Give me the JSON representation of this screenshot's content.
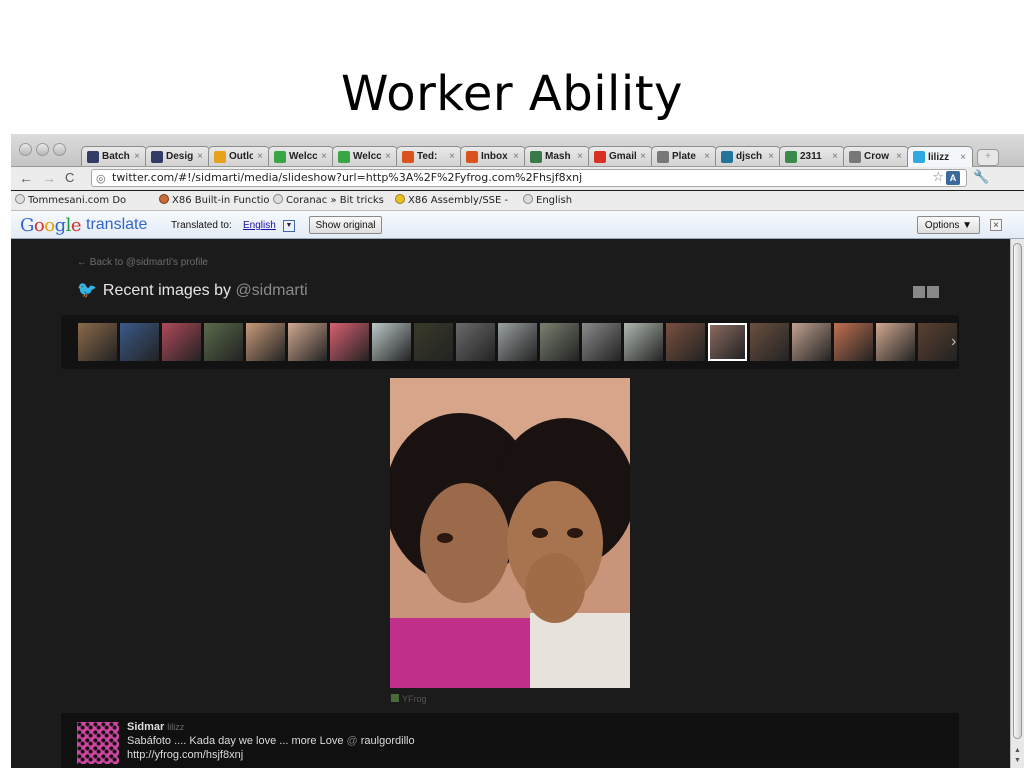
{
  "slide": {
    "title": "Worker Ability"
  },
  "browser": {
    "tabs": [
      {
        "label": "Batch",
        "icon": "batch-favicon",
        "color": "#333a66"
      },
      {
        "label": "Desig",
        "icon": "design-favicon",
        "color": "#333a66"
      },
      {
        "label": "Outlo",
        "icon": "outlook-favicon",
        "color": "#e6a21a"
      },
      {
        "label": "Welcc",
        "icon": "welcome-favicon",
        "color": "#3aa547"
      },
      {
        "label": "Welcc",
        "icon": "welcome-favicon",
        "color": "#3aa547"
      },
      {
        "label": "Ted:",
        "icon": "ted-favicon",
        "color": "#d9531e"
      },
      {
        "label": "Inbox",
        "icon": "inbox-favicon",
        "color": "#d9531e"
      },
      {
        "label": "Mash",
        "icon": "mashable-favicon",
        "color": "#3a7a4a"
      },
      {
        "label": "Gmail",
        "icon": "gmail-favicon",
        "color": "#d93025"
      },
      {
        "label": "Plate",
        "icon": "wikipedia-favicon",
        "color": "#777777"
      },
      {
        "label": "djsch",
        "icon": "wordpress-favicon",
        "color": "#21759b"
      },
      {
        "label": "2311",
        "icon": "chart-favicon",
        "color": "#3a8a4a"
      },
      {
        "label": "Crow",
        "icon": "wikipedia-favicon",
        "color": "#777777"
      },
      {
        "label": "lilizz",
        "icon": "twitter-favicon",
        "color": "#2fa9e0"
      }
    ],
    "url": "twitter.com/#!/sidmarti/media/slideshow?url=http%3A%2F%2Fyfrog.com%2Fhsjf8xnj",
    "bookmarks": [
      {
        "label": "Tommesani.com Do"
      },
      {
        "label": "X86 Built-in Functio"
      },
      {
        "label": "Coranac » Bit tricks"
      },
      {
        "label": "X86 Assembly/SSE -"
      },
      {
        "label": "English"
      }
    ]
  },
  "translate": {
    "logo_google": "Google",
    "logo_translate": "translate",
    "translated_to_label": "Translated to:",
    "language": "English",
    "show_original": "Show original",
    "options": "Options ▼",
    "close": "×"
  },
  "page": {
    "back_link": "← Back to @sidmarti's profile",
    "recent_title": "Recent images by",
    "recent_handle": "@sidmarti",
    "thumbnails": [
      {
        "color": "#8b6a4a"
      },
      {
        "color": "#3b5a8a"
      },
      {
        "color": "#b04a5a"
      },
      {
        "color": "#5a6a4a"
      },
      {
        "color": "#c89a7a"
      },
      {
        "color": "#d0a890"
      },
      {
        "color": "#d86070"
      },
      {
        "color": "#bcc8c8"
      },
      {
        "color": "#3a3a2a"
      },
      {
        "color": "#6a6a6a"
      },
      {
        "color": "#9aa0a0"
      },
      {
        "color": "#7a8070"
      },
      {
        "color": "#8a8a8a"
      },
      {
        "color": "#b0b8b0"
      },
      {
        "color": "#7a5040"
      },
      {
        "color": "#8a6a60"
      },
      {
        "color": "#6a5040"
      },
      {
        "color": "#c0a090"
      },
      {
        "color": "#c07050"
      },
      {
        "color": "#d0a890"
      },
      {
        "color": "#5a4030"
      },
      {
        "color": "#7a5a40"
      }
    ],
    "selected_thumbnail": 15,
    "photo_source": "YFrog",
    "tweet": {
      "author": "Sidmar",
      "handle": "lilizz",
      "text": "Sabáfoto .... Kada day we love ... more Love",
      "mention_at": "@",
      "mention": "raulgordillo",
      "link": "http://yfrog.com/hsjf8xnj"
    }
  }
}
